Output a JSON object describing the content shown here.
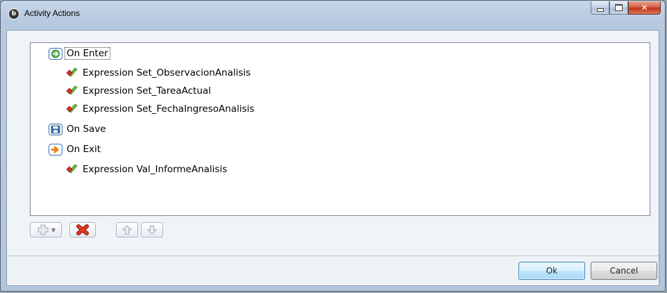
{
  "window": {
    "title": "Activity Actions"
  },
  "tree": {
    "on_enter": {
      "label": "On Enter",
      "children": [
        "Expression Set_ObservacionAnalisis",
        "Expression Set_TareaActual",
        "Expression Set_FechaIngresoAnalisis"
      ]
    },
    "on_save": {
      "label": "On Save",
      "children": []
    },
    "on_exit": {
      "label": "On Exit",
      "children": [
        "Expression Val_InformeAnalisis"
      ]
    }
  },
  "footer": {
    "ok_label": "Ok",
    "cancel_label": "Cancel"
  },
  "colors": {
    "title_bar": "#b9cbe0",
    "close_button": "#c8412a",
    "tree_border": "#828790",
    "event_icon_border": "#3b6fb0",
    "default_button": "#bee6fd"
  },
  "icons": {
    "app": "app-logo-icon",
    "on_enter": "enter-arrow-icon",
    "on_save": "save-disk-icon",
    "on_exit": "exit-arrow-icon",
    "expression": "expression-gem-icon",
    "add": "add-plus-icon",
    "delete": "delete-x-icon",
    "move_up": "arrow-up-icon",
    "move_down": "arrow-down-icon"
  }
}
